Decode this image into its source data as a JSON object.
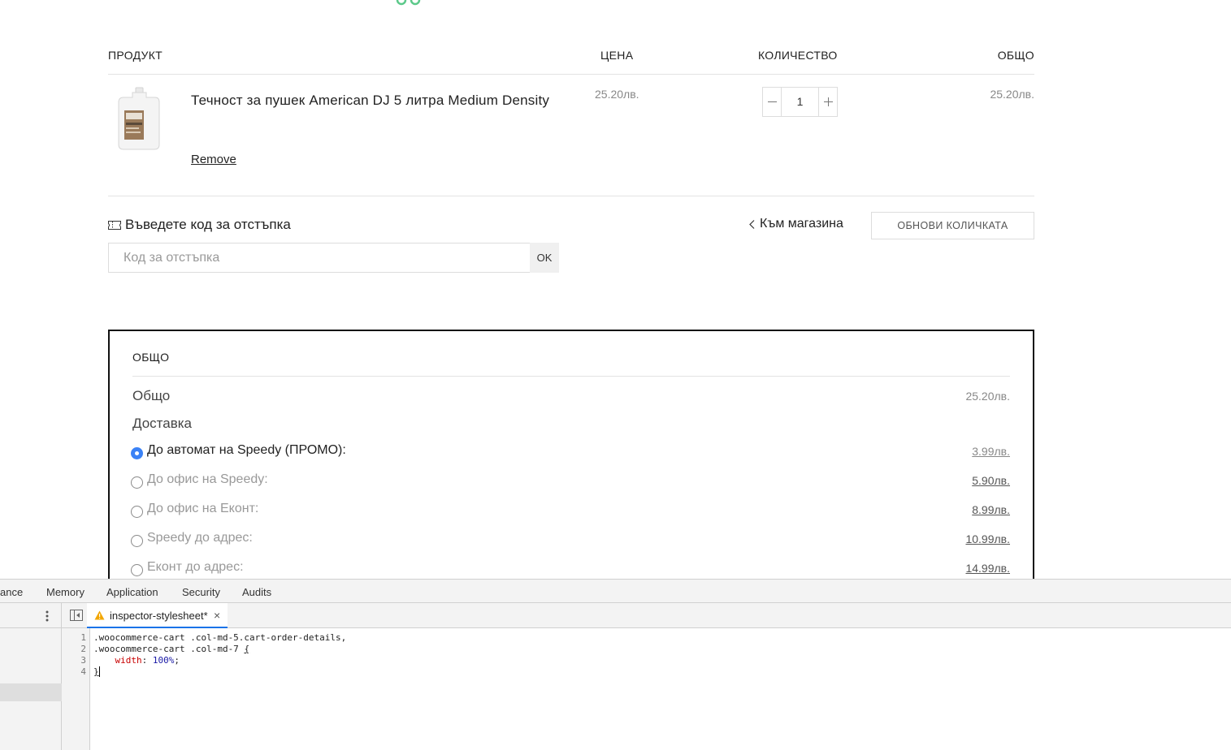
{
  "cart_table": {
    "headers": {
      "product": "ПРОДУКТ",
      "price": "ЦЕНА",
      "quantity": "КОЛИЧЕСТВО",
      "total": "ОБЩО"
    },
    "items": [
      {
        "title": "Течност за пушек American DJ 5 литра Medium Density",
        "remove_label": "Remove",
        "price": "25.20лв.",
        "quantity": "1",
        "total": "25.20лв."
      }
    ]
  },
  "coupon": {
    "label": "Въведете код за отстъпка",
    "placeholder": "Код за отстъпка",
    "submit_label": "OK"
  },
  "actions": {
    "back_to_shop": "Към магазина",
    "update_cart": "ОБНОВИ КОЛИЧКАТА"
  },
  "totals": {
    "heading": "ОБЩО",
    "subtotal_label": "Общо",
    "subtotal_value": "25.20лв.",
    "shipping_label": "Доставка",
    "shipping_options": [
      {
        "name": "До автомат на Speedy (ПРОМО):",
        "price": "3.99лв.",
        "selected": true
      },
      {
        "name": "До офис на Speedy:",
        "price": "5.90лв.",
        "selected": false
      },
      {
        "name": "До офис на Еконт:",
        "price": "8.99лв.",
        "selected": false
      },
      {
        "name": "Speedy до адрес:",
        "price": "10.99лв.",
        "selected": false
      },
      {
        "name": "Еконт до адрес:",
        "price": "14.99лв.",
        "selected": false
      }
    ]
  },
  "devtools": {
    "tabs": [
      "ance",
      "Memory",
      "Application",
      "Security",
      "Audits"
    ],
    "file_tab": "inspector-stylesheet*",
    "line_numbers": [
      "1",
      "2",
      "3",
      "4"
    ],
    "code": {
      "line1": ".woocommerce-cart .col-md-5.cart-order-details,",
      "line2_selector": ".woocommerce-cart .col-md-7 ",
      "line2_brace": "{",
      "line3_indent": "    ",
      "line3_prop": "width",
      "line3_colon": ": ",
      "line3_value": "100%",
      "line3_semi": ";",
      "line4": "}"
    }
  },
  "colors": {
    "accent_blue": "#3b82f6",
    "tab_underline": "#1a73e8",
    "deco_green": "#5cc98a"
  },
  "icons": [
    "coupon-ticket-icon",
    "chevron-left-icon",
    "minus-icon",
    "plus-icon",
    "kebab-menu-icon",
    "sidebar-toggle-icon",
    "warning-icon",
    "close-icon"
  ]
}
